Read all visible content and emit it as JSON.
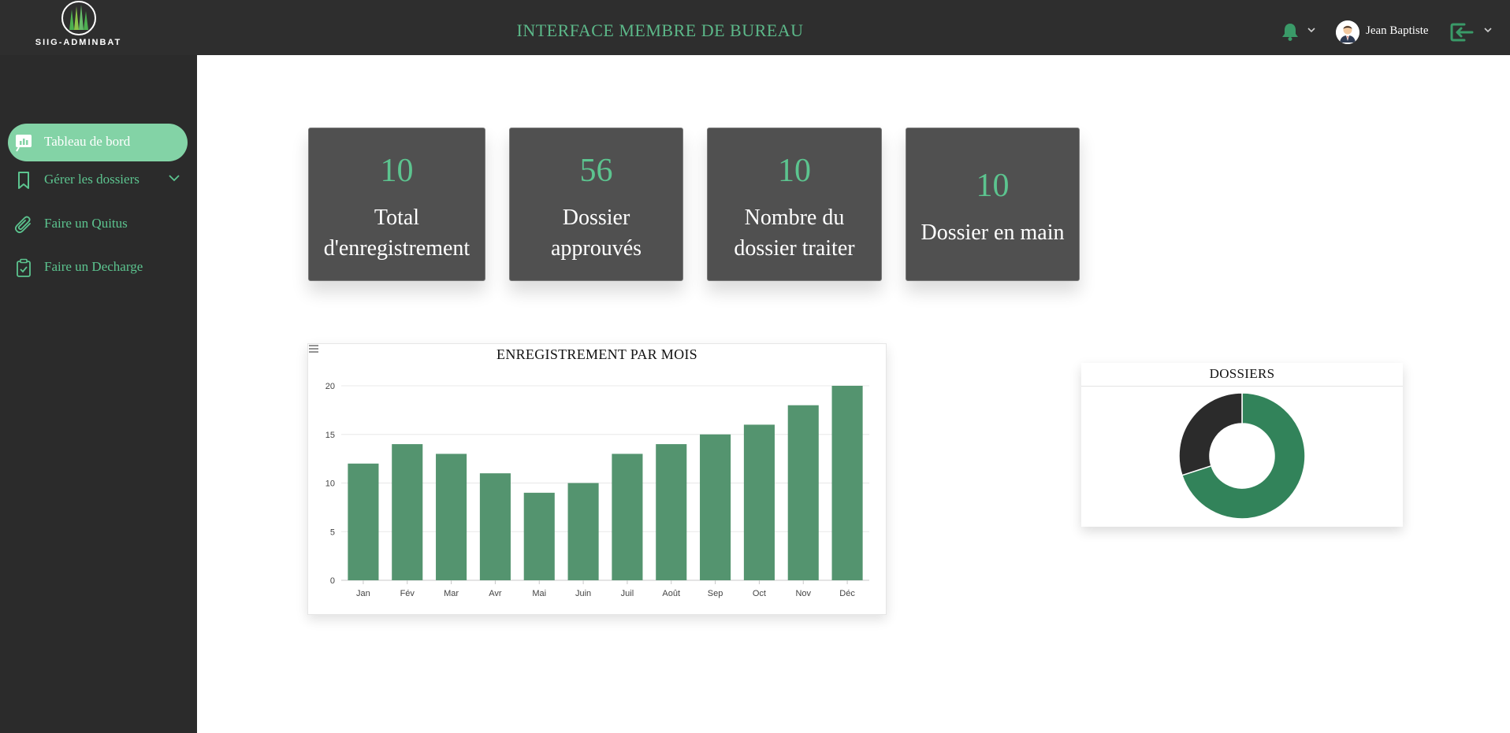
{
  "header": {
    "logo_text": "SIIG-ADMINBAT",
    "title": "INTERFACE MEMBRE DE BUREAU",
    "user_name": "Jean Baptiste",
    "icons": [
      "bell-icon",
      "chevron-down-icon",
      "avatar",
      "logout-icon",
      "chevron-down-icon"
    ]
  },
  "sidebar": {
    "items": [
      {
        "label": "Tableau de bord",
        "icon": "dashboard-icon",
        "active": true
      },
      {
        "label": "Gérer les dossiers",
        "icon": "bookmark-icon",
        "has_submenu": true
      },
      {
        "label": "Faire un Quitus",
        "icon": "paperclip-icon"
      },
      {
        "label": "Faire un Decharge",
        "icon": "clipboard-check-icon"
      }
    ]
  },
  "stats": [
    {
      "value": "10",
      "label_line1": "Total",
      "label_line2": "d'enregistrement"
    },
    {
      "value": "56",
      "label_line1": "Dossier",
      "label_line2": "approuvés"
    },
    {
      "value": "10",
      "label_line1": "Nombre du",
      "label_line2": "dossier traiter"
    },
    {
      "value": "10",
      "label_line1": "Dossier en main",
      "label_line2": ""
    }
  ],
  "chart_data": [
    {
      "type": "bar",
      "title": "ENREGISTREMENT PAR MOIS",
      "categories": [
        "Jan",
        "Fév",
        "Mar",
        "Avr",
        "Mai",
        "Juin",
        "Juil",
        "Août",
        "Sep",
        "Oct",
        "Nov",
        "Déc"
      ],
      "values": [
        12,
        14,
        13,
        11,
        9,
        10,
        13,
        14,
        15,
        16,
        18,
        20
      ],
      "ylim": [
        0,
        20
      ],
      "yticks": [
        0,
        5,
        10,
        15,
        20
      ],
      "xlabel": "",
      "ylabel": "",
      "grid": true,
      "color": "#54946f"
    },
    {
      "type": "pie",
      "title": "DOSSIERS",
      "values": [
        70,
        30
      ],
      "colors": [
        "#32835a",
        "#2b2b2b"
      ],
      "donut": true
    }
  ],
  "colors": {
    "accent": "#5cc48f",
    "accent_light": "#83d3a6",
    "dark": "#2e2e2e",
    "card_bg": "#505050"
  }
}
